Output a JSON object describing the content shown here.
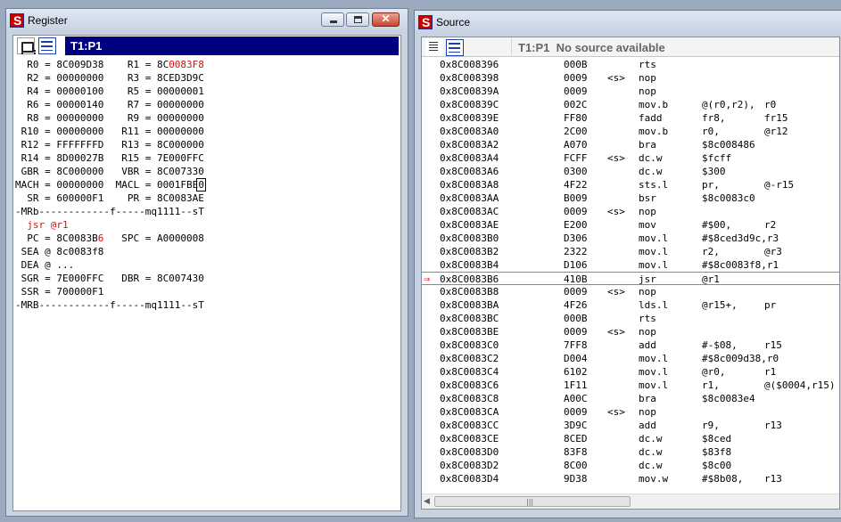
{
  "register_window": {
    "title": "Register",
    "tab_label": "T1:P1",
    "lines": [
      {
        "parts": [
          {
            "t": "  R0 = 8C009D38    R1 = 8C"
          },
          {
            "t": "0083F8",
            "red": true
          }
        ]
      },
      {
        "parts": [
          {
            "t": "  R2 = 00000000    R3 = 8CED3D9C"
          }
        ]
      },
      {
        "parts": [
          {
            "t": "  R4 = 00000100    R5 = 00000001"
          }
        ]
      },
      {
        "parts": [
          {
            "t": "  R6 = 00000140    R7 = 00000000"
          }
        ]
      },
      {
        "parts": [
          {
            "t": "  R8 = 00000000    R9 = 00000000"
          }
        ]
      },
      {
        "parts": [
          {
            "t": " R10 = 00000000   R11 = 00000000"
          }
        ]
      },
      {
        "parts": [
          {
            "t": " R12 = FFFFFFFD   R13 = 8C000000"
          }
        ]
      },
      {
        "parts": [
          {
            "t": " R14 = 8D00027B   R15 = 7E000FFC"
          }
        ]
      },
      {
        "parts": [
          {
            "t": " GBR = 8C000000   VBR = 8C007330"
          }
        ]
      },
      {
        "parts": [
          {
            "t": "MACH = 00000000  MACL = 0001FBE"
          },
          {
            "t": "0",
            "box": true
          }
        ]
      },
      {
        "parts": [
          {
            "t": "  SR = 600000F1    PR = 8C0083AE"
          }
        ]
      },
      {
        "parts": [
          {
            "t": "-MRb------------f-----mq1111--sT"
          }
        ]
      },
      {
        "parts": [
          {
            "t": "  jsr @r1",
            "red": true
          }
        ]
      },
      {
        "parts": [
          {
            "t": "  PC = 8C0083B"
          },
          {
            "t": "6",
            "red": true
          },
          {
            "t": "   SPC = A0000008"
          }
        ]
      },
      {
        "parts": [
          {
            "t": " SEA @ 8c0083f8"
          }
        ]
      },
      {
        "parts": [
          {
            "t": " DEA @ ..."
          }
        ]
      },
      {
        "parts": [
          {
            "t": " SGR = 7E000FFC   DBR = 8C007430"
          }
        ]
      },
      {
        "parts": [
          {
            "t": " SSR = 700000F1"
          }
        ]
      },
      {
        "parts": [
          {
            "t": "-MRB------------f-----mq1111--sT"
          }
        ]
      }
    ]
  },
  "source_window": {
    "title": "Source",
    "header_label": "T1:P1  No source available",
    "current_row": 16,
    "rows": [
      {
        "addr": "0x8C008396",
        "code": "000B",
        "mark": "",
        "mnem": "rts",
        "op1": "",
        "op2": ""
      },
      {
        "addr": "0x8C008398",
        "code": "0009",
        "mark": "<s>",
        "mnem": "nop",
        "op1": "",
        "op2": ""
      },
      {
        "addr": "0x8C00839A",
        "code": "0009",
        "mark": "",
        "mnem": "nop",
        "op1": "",
        "op2": ""
      },
      {
        "addr": "0x8C00839C",
        "code": "002C",
        "mark": "",
        "mnem": "mov.b",
        "op1": "@(r0,r2),",
        "op2": "r0"
      },
      {
        "addr": "0x8C00839E",
        "code": "FF80",
        "mark": "",
        "mnem": "fadd",
        "op1": "fr8,",
        "op2": "fr15"
      },
      {
        "addr": "0x8C0083A0",
        "code": "2C00",
        "mark": "",
        "mnem": "mov.b",
        "op1": "r0,",
        "op2": "@r12"
      },
      {
        "addr": "0x8C0083A2",
        "code": "A070",
        "mark": "",
        "mnem": "bra",
        "op1": "$8c008486",
        "op2": ""
      },
      {
        "addr": "0x8C0083A4",
        "code": "FCFF",
        "mark": "<s>",
        "mnem": "dc.w",
        "op1": "$fcff",
        "op2": ""
      },
      {
        "addr": "0x8C0083A6",
        "code": "0300",
        "mark": "",
        "mnem": "dc.w",
        "op1": "$300",
        "op2": ""
      },
      {
        "addr": "0x8C0083A8",
        "code": "4F22",
        "mark": "",
        "mnem": "sts.l",
        "op1": "pr,",
        "op2": "@-r15"
      },
      {
        "addr": "0x8C0083AA",
        "code": "B009",
        "mark": "",
        "mnem": "bsr",
        "op1": "$8c0083c0",
        "op2": ""
      },
      {
        "addr": "0x8C0083AC",
        "code": "0009",
        "mark": "<s>",
        "mnem": "nop",
        "op1": "",
        "op2": ""
      },
      {
        "addr": "0x8C0083AE",
        "code": "E200",
        "mark": "",
        "mnem": "mov",
        "op1": "#$00,",
        "op2": "r2"
      },
      {
        "addr": "0x8C0083B0",
        "code": "D306",
        "mark": "",
        "mnem": "mov.l",
        "op1": "#$8ced3d9c,r3",
        "op2": ""
      },
      {
        "addr": "0x8C0083B2",
        "code": "2322",
        "mark": "",
        "mnem": "mov.l",
        "op1": "r2,",
        "op2": "@r3"
      },
      {
        "addr": "0x8C0083B4",
        "code": "D106",
        "mark": "",
        "mnem": "mov.l",
        "op1": "#$8c0083f8,r1",
        "op2": ""
      },
      {
        "addr": "0x8C0083B6",
        "code": "410B",
        "mark": "",
        "mnem": "jsr",
        "op1": "@r1",
        "op2": ""
      },
      {
        "addr": "0x8C0083B8",
        "code": "0009",
        "mark": "<s>",
        "mnem": "nop",
        "op1": "",
        "op2": ""
      },
      {
        "addr": "0x8C0083BA",
        "code": "4F26",
        "mark": "",
        "mnem": "lds.l",
        "op1": "@r15+,",
        "op2": "pr"
      },
      {
        "addr": "0x8C0083BC",
        "code": "000B",
        "mark": "",
        "mnem": "rts",
        "op1": "",
        "op2": ""
      },
      {
        "addr": "0x8C0083BE",
        "code": "0009",
        "mark": "<s>",
        "mnem": "nop",
        "op1": "",
        "op2": ""
      },
      {
        "addr": "0x8C0083C0",
        "code": "7FF8",
        "mark": "",
        "mnem": "add",
        "op1": "#-$08,",
        "op2": "r15"
      },
      {
        "addr": "0x8C0083C2",
        "code": "D004",
        "mark": "",
        "mnem": "mov.l",
        "op1": "#$8c009d38,r0",
        "op2": ""
      },
      {
        "addr": "0x8C0083C4",
        "code": "6102",
        "mark": "",
        "mnem": "mov.l",
        "op1": "@r0,",
        "op2": "r1"
      },
      {
        "addr": "0x8C0083C6",
        "code": "1F11",
        "mark": "",
        "mnem": "mov.l",
        "op1": "r1,",
        "op2": "@($0004,r15)"
      },
      {
        "addr": "0x8C0083C8",
        "code": "A00C",
        "mark": "",
        "mnem": "bra",
        "op1": "$8c0083e4",
        "op2": ""
      },
      {
        "addr": "0x8C0083CA",
        "code": "0009",
        "mark": "<s>",
        "mnem": "nop",
        "op1": "",
        "op2": ""
      },
      {
        "addr": "0x8C0083CC",
        "code": "3D9C",
        "mark": "",
        "mnem": "add",
        "op1": "r9,",
        "op2": "r13"
      },
      {
        "addr": "0x8C0083CE",
        "code": "8CED",
        "mark": "",
        "mnem": "dc.w",
        "op1": "$8ced",
        "op2": ""
      },
      {
        "addr": "0x8C0083D0",
        "code": "83F8",
        "mark": "",
        "mnem": "dc.w",
        "op1": "$83f8",
        "op2": ""
      },
      {
        "addr": "0x8C0083D2",
        "code": "8C00",
        "mark": "",
        "mnem": "dc.w",
        "op1": "$8c00",
        "op2": ""
      },
      {
        "addr": "0x8C0083D4",
        "code": "9D38",
        "mark": "",
        "mnem": "mov.w",
        "op1": "#$8b08,",
        "op2": "r13"
      }
    ]
  },
  "icons": {
    "app": "renesas-app-icon",
    "current_pc": "red-arrow-icon"
  },
  "colors": {
    "highlight_red": "#d41010",
    "tab_blue": "#000080"
  }
}
